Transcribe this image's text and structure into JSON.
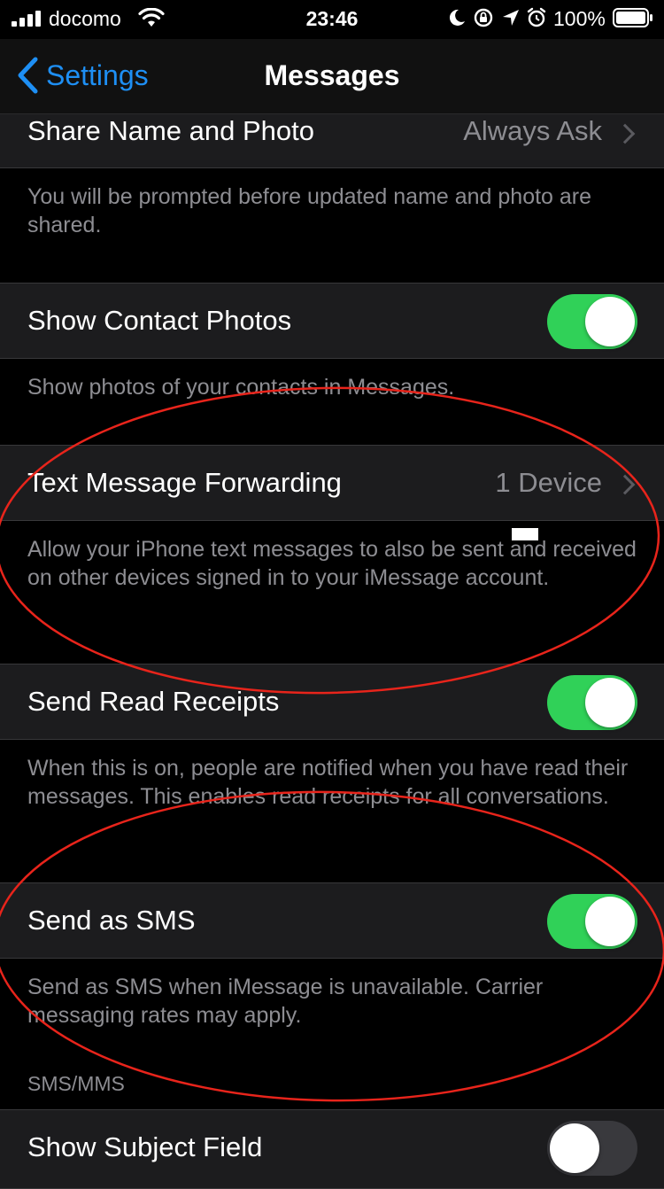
{
  "status_bar": {
    "carrier": "docomo",
    "time": "23:46",
    "battery_percent": "100%",
    "signal_bars": 4,
    "icons": [
      "signal-icon",
      "wifi-icon",
      "moon-icon",
      "rotation-lock-icon",
      "location-icon",
      "alarm-icon",
      "battery-icon"
    ]
  },
  "nav": {
    "back_label": "Settings",
    "title": "Messages"
  },
  "rows": {
    "share_name": {
      "label": "Share Name and Photo",
      "value": "Always Ask"
    },
    "share_name_footer": "You will be prompted before updated name and photo are shared.",
    "contact_photos": {
      "label": "Show Contact Photos",
      "on": true
    },
    "contact_photos_footer": "Show photos of your contacts in Messages.",
    "text_forwarding": {
      "label": "Text Message Forwarding",
      "value": "1 Device"
    },
    "text_forwarding_footer": "Allow your iPhone text messages to also be sent and received on other devices signed in to your iMessage account.",
    "read_receipts": {
      "label": "Send Read Receipts",
      "on": true
    },
    "read_receipts_footer": "When this is on, people are notified when you have read their messages. This enables read receipts for all conversations.",
    "send_sms": {
      "label": "Send as SMS",
      "on": true
    },
    "send_sms_footer": "Send as SMS when iMessage is unavailable. Carrier messaging rates may apply.",
    "sms_mms_header": "SMS/MMS",
    "subject_field": {
      "label": "Show Subject Field",
      "on": false
    }
  },
  "colors": {
    "accent_blue": "#1e8ff4",
    "toggle_on": "#30d158",
    "toggle_off": "#39393d",
    "annotation_red": "#e8241b",
    "cell_bg": "#1c1c1e"
  }
}
